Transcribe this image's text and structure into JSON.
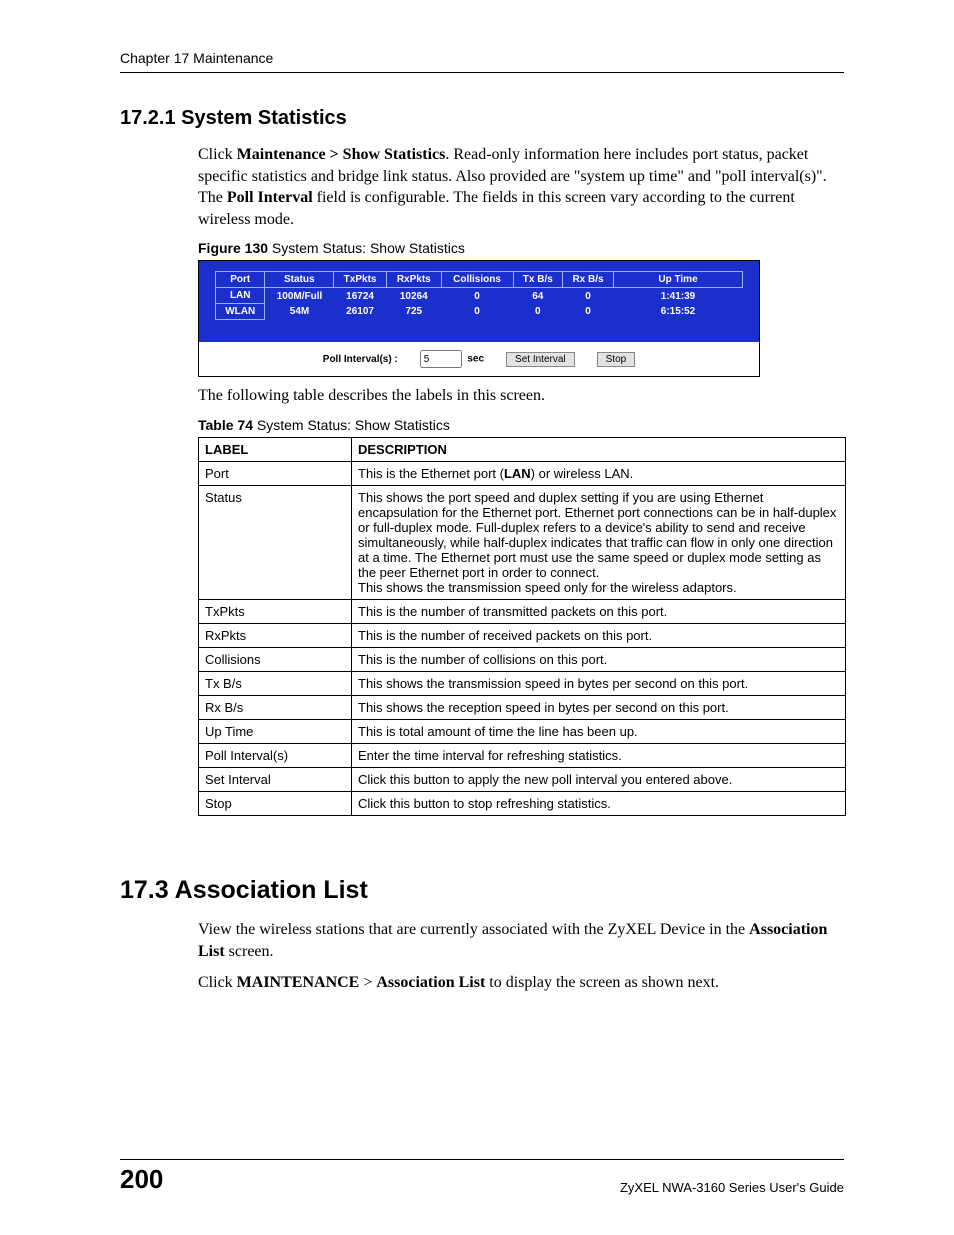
{
  "header": {
    "chapter": "Chapter 17 Maintenance"
  },
  "section1": {
    "number_title": "17.2.1  System Statistics",
    "para_parts": {
      "pre1": "Click ",
      "b1": "Maintenance > Show Statistics",
      "mid1": ". Read-only information here includes port status, packet specific statistics and bridge link status. Also provided are \"system up time\" and \"poll interval(s)\".  The ",
      "b2": "Poll Interval",
      "end1": " field is configurable. The fields in this screen vary according to the current wireless mode."
    },
    "figure_caption_b": "Figure 130",
    "figure_caption_rest": "   System Status: Show Statistics"
  },
  "stats": {
    "headers": [
      "Port",
      "Status",
      "TxPkts",
      "RxPkts",
      "Collisions",
      "Tx B/s",
      "Rx B/s",
      "Up Time"
    ],
    "rows": [
      [
        "LAN",
        "100M/Full",
        "16724",
        "10264",
        "0",
        "64",
        "0",
        "1:41:39"
      ],
      [
        "WLAN",
        "54M",
        "26107",
        "725",
        "0",
        "0",
        "0",
        "6:15:52"
      ]
    ],
    "poll_label": "Poll Interval(s) :",
    "poll_value": "5",
    "poll_unit": "sec",
    "set_btn": "Set Interval",
    "stop_btn": "Stop"
  },
  "followup_text": "The following table describes the labels in this screen.",
  "table_caption_b": "Table 74",
  "table_caption_rest": "   System Status: Show Statistics",
  "labeldesc": {
    "head_label": "LABEL",
    "head_desc": "DESCRIPTION",
    "rows": [
      {
        "label": "Port",
        "desc_pre": "This is the Ethernet port (",
        "desc_b": "LAN",
        "desc_post": ") or wireless LAN."
      },
      {
        "label": "Status",
        "desc": "This shows the port speed and duplex setting if you are using Ethernet encapsulation for the Ethernet port. Ethernet port connections can be in half-duplex or full-duplex mode. Full-duplex refers to a device's ability to send and receive simultaneously, while half-duplex indicates that traffic can flow in only one direction at a time. The Ethernet port must use the same speed or duplex mode setting as the peer Ethernet port in order to connect.\nThis shows the transmission speed only for the wireless adaptors."
      },
      {
        "label": "TxPkts",
        "desc": "This is the number of transmitted packets on this port."
      },
      {
        "label": "RxPkts",
        "desc": "This is the number of received packets on this port."
      },
      {
        "label": "Collisions",
        "desc": "This is the number of collisions on this port."
      },
      {
        "label": "Tx B/s",
        "desc": "This shows the transmission speed in bytes per second on this port."
      },
      {
        "label": "Rx B/s",
        "desc": "This shows the reception speed in bytes per second on this port."
      },
      {
        "label": "Up Time",
        "desc": "This is total amount of time the line has been up."
      },
      {
        "label": "Poll Interval(s)",
        "desc": "Enter the time interval for refreshing statistics."
      },
      {
        "label": "Set Interval",
        "desc": "Click this button to apply the new poll interval you entered above."
      },
      {
        "label": "Stop",
        "desc": "Click this button to stop refreshing statistics."
      }
    ]
  },
  "section2": {
    "number_title": "17.3  Association List",
    "p1_pre": "View the wireless stations that are currently associated with the ZyXEL Device in the ",
    "p1_b": "Association List",
    "p1_post": " screen.",
    "p2_pre": "Click ",
    "p2_b1": "MAINTENANCE",
    "p2_mid": " > ",
    "p2_b2": "Association List",
    "p2_post": " to display the screen as shown next."
  },
  "footer": {
    "page": "200",
    "guide": "ZyXEL NWA-3160 Series User's Guide"
  }
}
